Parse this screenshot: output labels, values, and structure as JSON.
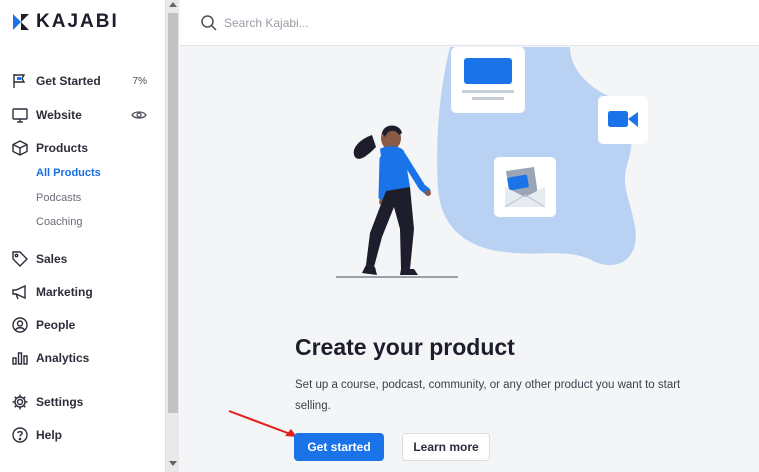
{
  "brand": {
    "name": "KAJABI",
    "accent": "#1a73e8"
  },
  "search": {
    "placeholder": "Search Kajabi..."
  },
  "sidebar": {
    "items": [
      {
        "label": "Get Started",
        "icon": "flag-icon",
        "badge": "7%"
      },
      {
        "label": "Website",
        "icon": "monitor-icon",
        "trailing_icon": "eye-icon"
      },
      {
        "label": "Products",
        "icon": "box-icon",
        "children": [
          {
            "label": "All Products",
            "active": true
          },
          {
            "label": "Podcasts",
            "active": false
          },
          {
            "label": "Coaching",
            "active": false
          }
        ]
      },
      {
        "label": "Sales",
        "icon": "tag-icon"
      },
      {
        "label": "Marketing",
        "icon": "megaphone-icon"
      },
      {
        "label": "People",
        "icon": "person-circle-icon"
      },
      {
        "label": "Analytics",
        "icon": "bar-chart-icon"
      },
      {
        "label": "Settings",
        "icon": "gear-icon"
      },
      {
        "label": "Help",
        "icon": "question-circle-icon"
      }
    ]
  },
  "main": {
    "heading": "Create your product",
    "description": "Set up a course, podcast, community, or any other product you want to start selling.",
    "primary_button": "Get started",
    "secondary_button": "Learn more"
  }
}
